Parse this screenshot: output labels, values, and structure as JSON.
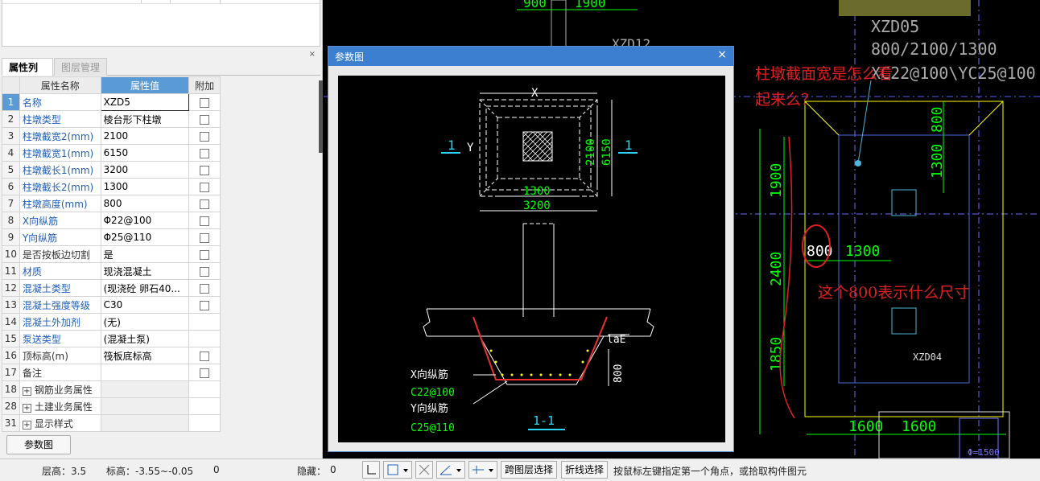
{
  "left_panel": {
    "tabs": [
      "属性列表",
      "图层管理"
    ],
    "close_glyph": "×",
    "columns": [
      "属性名称",
      "属性值",
      "附加"
    ],
    "rows": [
      {
        "num": "1",
        "name": "名称",
        "value": "XZD5"
      },
      {
        "num": "2",
        "name": "柱墩类型",
        "value": "棱台形下柱墩"
      },
      {
        "num": "3",
        "name": "柱墩截宽2(mm)",
        "value": "2100"
      },
      {
        "num": "4",
        "name": "柱墩截宽1(mm)",
        "value": "6150"
      },
      {
        "num": "5",
        "name": "柱墩截长1(mm)",
        "value": "3200"
      },
      {
        "num": "6",
        "name": "柱墩截长2(mm)",
        "value": "1300"
      },
      {
        "num": "7",
        "name": "柱墩高度(mm)",
        "value": "800"
      },
      {
        "num": "8",
        "name": "X向纵筋",
        "value": "Φ22@100"
      },
      {
        "num": "9",
        "name": "Y向纵筋",
        "value": "Φ25@110"
      },
      {
        "num": "10",
        "name": "是否按板边切割",
        "value": "是"
      },
      {
        "num": "11",
        "name": "材质",
        "value": "现浇混凝土"
      },
      {
        "num": "12",
        "name": "混凝土类型",
        "value": "(现浇砼 卵石40..."
      },
      {
        "num": "13",
        "name": "混凝土强度等级",
        "value": "C30"
      },
      {
        "num": "14",
        "name": "混凝土外加剂",
        "value": "(无)"
      },
      {
        "num": "15",
        "name": "泵送类型",
        "value": "(混凝土泵)"
      },
      {
        "num": "16",
        "name": "顶标高(m)",
        "value": "筏板底标高"
      },
      {
        "num": "17",
        "name": "备注",
        "value": ""
      },
      {
        "num": "18",
        "name": "钢筋业务属性",
        "value": ""
      },
      {
        "num": "28",
        "name": "土建业务属性",
        "value": ""
      },
      {
        "num": "31",
        "name": "显示样式",
        "value": ""
      }
    ],
    "param_button": "参数图"
  },
  "dialog": {
    "title": "参数图",
    "close_glyph": "×",
    "labels": {
      "x": "X",
      "y": "Y",
      "one_left": "1",
      "one_right": "1",
      "dim_2100": "2100",
      "dim_6150": "6150",
      "dim_1300": "1300",
      "dim_3200": "3200",
      "lae": "laE",
      "dim_800": "800",
      "x_bar": "X向纵筋",
      "x_bar_spec": "C22@100",
      "y_bar": "Y向纵筋",
      "y_bar_spec": "C25@110",
      "section": "1-1"
    }
  },
  "cad": {
    "top_dims": [
      "900",
      "1900"
    ],
    "xzd12": "XZD12",
    "xzd05": "XZD05",
    "xzd05_size": "800/2100/1300",
    "xzd05_bars": "XC22@100\\YC25@100",
    "question1_line1": "柱墩截面宽是怎么看",
    "question1_line2": "起来么？",
    "question2": "这个800表示什么尺寸",
    "dims": {
      "d800a": "800",
      "d1300a": "1300",
      "d1900": "1900",
      "d2400": "2400",
      "d1850": "1850",
      "d800b": "800",
      "d1300b": "1300",
      "d1600a": "1600",
      "d1600b": "1600"
    },
    "xzd04": "XZD04",
    "corner": "Φ=1500"
  },
  "status": {
    "floor_height": "层高：3.5",
    "elevation": "标高：-3.55~-0.05",
    "zero": "0",
    "hidden": "隐藏：",
    "hidden_count": "0",
    "cross_layer": "跨图层选择",
    "polyline": "折线选择",
    "hint": "按鼠标左键指定第一个角点，或拾取构件图元"
  }
}
